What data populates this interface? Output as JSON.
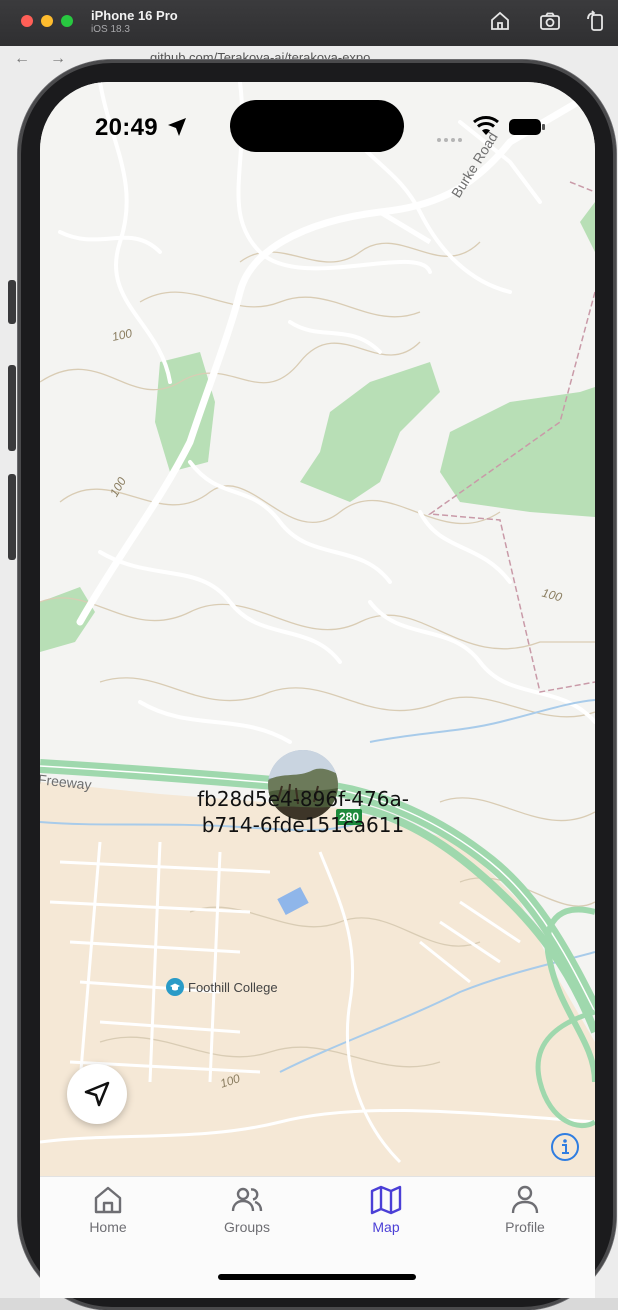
{
  "simulator": {
    "device_name": "iPhone 16 Pro",
    "os_version": "iOS 18.3",
    "background_url": "github.com/Terakoya-ai/terakoya-expo"
  },
  "status_bar": {
    "time": "20:49"
  },
  "map": {
    "road_labels": [
      "Burke Road",
      "Freeway"
    ],
    "contour_labels": [
      "100",
      "100",
      "100",
      "100"
    ],
    "highway_shield": "280",
    "poi": {
      "name": "Foothill College",
      "icon": "graduation-cap-icon"
    },
    "marker": {
      "label": "fb28d5e4-896f-476a-b714-6fde151ca611",
      "avatar_icon": "user-photo-avatar"
    }
  },
  "controls": {
    "recenter_icon": "location-arrow-icon",
    "info_icon": "info-icon"
  },
  "tabs": [
    {
      "label": "Home",
      "icon": "home-icon",
      "active": false
    },
    {
      "label": "Groups",
      "icon": "groups-icon",
      "active": false
    },
    {
      "label": "Map",
      "icon": "map-icon",
      "active": true
    },
    {
      "label": "Profile",
      "icon": "profile-icon",
      "active": false
    }
  ],
  "colors": {
    "accent": "#4b3fd6",
    "inactive": "#6e6e73",
    "park": "#b8dfb6",
    "freeway": "#9fd8ad",
    "urban": "#f5e8d6",
    "water": "#a8cbea"
  }
}
